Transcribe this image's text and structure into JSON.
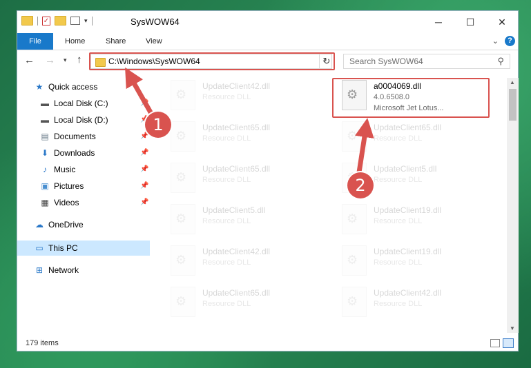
{
  "window": {
    "title": "SysWOW64",
    "minimize_glyph": "─",
    "maximize_glyph": "☐",
    "close_glyph": "✕"
  },
  "ribbon": {
    "tabs": [
      "File",
      "Home",
      "Share",
      "View"
    ],
    "help_glyph": "?"
  },
  "nav": {
    "address": "C:\\Windows\\SysWOW64",
    "search_placeholder": "Search SysWOW64"
  },
  "sidebar": {
    "items": [
      {
        "label": "Quick access",
        "icon": "star-icon",
        "pinned": false
      },
      {
        "label": "Local Disk (C:)",
        "icon": "drive-icon",
        "pinned": true
      },
      {
        "label": "Local Disk (D:)",
        "icon": "drive-icon",
        "pinned": true
      },
      {
        "label": "Documents",
        "icon": "document-icon",
        "pinned": true
      },
      {
        "label": "Downloads",
        "icon": "download-icon",
        "pinned": true
      },
      {
        "label": "Music",
        "icon": "music-icon",
        "pinned": true
      },
      {
        "label": "Pictures",
        "icon": "picture-icon",
        "pinned": true
      },
      {
        "label": "Videos",
        "icon": "video-icon",
        "pinned": true
      },
      {
        "label": "OneDrive",
        "icon": "cloud-icon",
        "pinned": false
      },
      {
        "label": "This PC",
        "icon": "computer-icon",
        "pinned": false,
        "selected": true
      },
      {
        "label": "Network",
        "icon": "network-icon",
        "pinned": false
      }
    ]
  },
  "files": {
    "highlighted": {
      "name": "a0004069.dll",
      "version": "4.0.6508.0",
      "description": "Microsoft Jet Lotus..."
    },
    "left_column": [
      {
        "name": "UpdateClient42.dll",
        "type": "Resource DLL"
      },
      {
        "name": "UpdateClient65.dll",
        "type": "Resource DLL"
      },
      {
        "name": "UpdateClient65.dll",
        "type": "Resource DLL"
      },
      {
        "name": "UpdateClient5.dll",
        "type": "Resource DLL"
      },
      {
        "name": "UpdateClient42.dll",
        "type": "Resource DLL"
      },
      {
        "name": "UpdateClient65.dll",
        "type": "Resource DLL"
      }
    ],
    "right_column": [
      {
        "name": "UpdateClient65.dll",
        "type": "Resource DLL"
      },
      {
        "name": "UpdateClient5.dll",
        "type": "Resource DLL"
      },
      {
        "name": "UpdateClient19.dll",
        "type": "Resource DLL"
      },
      {
        "name": "UpdateClient19.dll",
        "type": "Resource DLL"
      },
      {
        "name": "UpdateClient42.dll",
        "type": "Resource DLL"
      }
    ]
  },
  "status": {
    "item_count": "179 items"
  },
  "callouts": {
    "step1": "1",
    "step2": "2"
  },
  "colors": {
    "accent": "#1979ca",
    "highlight": "#d9534f",
    "selection": "#cce8ff"
  }
}
